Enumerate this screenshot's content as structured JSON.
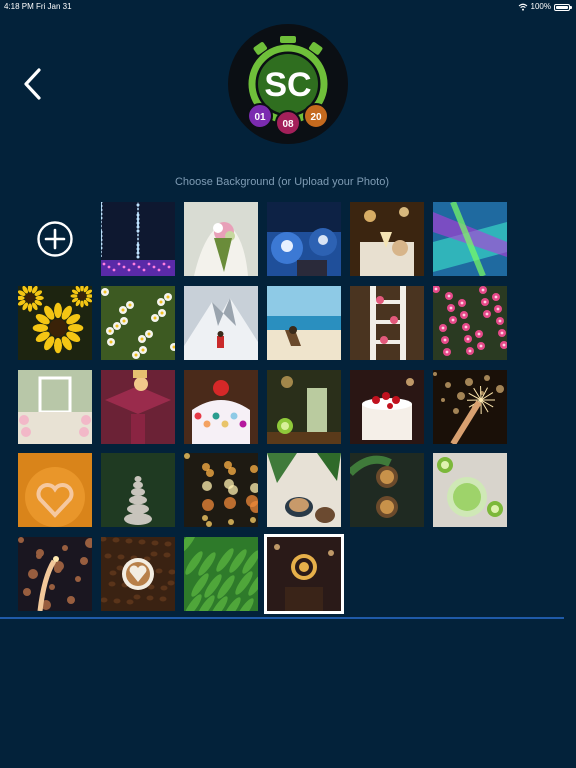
{
  "status_bar": {
    "time": "4:18 PM",
    "date": "Fri Jan 31",
    "battery_text": "100%",
    "battery_level": 1.0,
    "icons": [
      "wifi-icon",
      "battery-icon"
    ]
  },
  "logo": {
    "initials": "SC",
    "counters": [
      "01",
      "08",
      "20"
    ],
    "colors": {
      "timer": "#6fbf3a",
      "counter_1": "#7b2bb0",
      "counter_2": "#a3205a",
      "counter_3": "#c56a1e"
    }
  },
  "back_icon": "chevron-left-icon",
  "add_icon": "plus-circle-icon",
  "subtitle": "Choose Background (or Upload your Photo)",
  "backgrounds": [
    {
      "theme": "fireworks"
    },
    {
      "theme": "bride-bouquet"
    },
    {
      "theme": "party-tables"
    },
    {
      "theme": "wedding-toast"
    },
    {
      "theme": "neon-lights"
    },
    {
      "theme": "sunflowers"
    },
    {
      "theme": "daisies"
    },
    {
      "theme": "mountain-hiker"
    },
    {
      "theme": "beach-chairs"
    },
    {
      "theme": "white-ladder"
    },
    {
      "theme": "pink-blossoms"
    },
    {
      "theme": "wedding-aisle"
    },
    {
      "theme": "graduation-cap"
    },
    {
      "theme": "candy-cake"
    },
    {
      "theme": "cocktail-lime"
    },
    {
      "theme": "berry-cake"
    },
    {
      "theme": "sparkler"
    },
    {
      "theme": "pregnant-heart"
    },
    {
      "theme": "stone-stack"
    },
    {
      "theme": "bokeh-lights"
    },
    {
      "theme": "coffee-plants"
    },
    {
      "theme": "coffee-cups-top"
    },
    {
      "theme": "lime-drink"
    },
    {
      "theme": "sparkler-night"
    },
    {
      "theme": "latte-beans"
    },
    {
      "theme": "green-leaves"
    },
    {
      "theme": "dartboard",
      "selected": true
    }
  ],
  "colors": {
    "background": "#03223a",
    "subtitle": "#7f9cb4",
    "divider": "#1f5aa8"
  }
}
